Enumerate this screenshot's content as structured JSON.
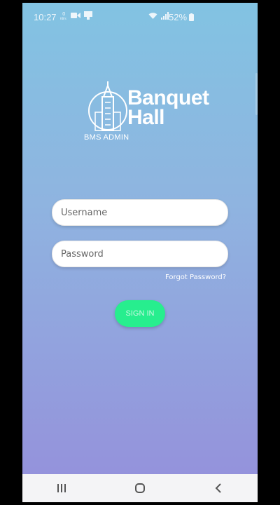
{
  "status_bar": {
    "time": "10:27",
    "battery": "52%",
    "icons_left": [
      "data-icon",
      "video-icon",
      "screen-icon"
    ],
    "icons_right": [
      "wifi-icon",
      "signal-icon",
      "battery-icon"
    ]
  },
  "logo": {
    "title_line1": "Banquet",
    "title_line2": "Hall",
    "subtitle": "BMS ADMIN"
  },
  "form": {
    "username_placeholder": "Username",
    "password_placeholder": "Password",
    "forgot_label": "Forgot Password?",
    "signin_label": "SIGN IN"
  },
  "colors": {
    "bg_top": "#82c3e2",
    "bg_bottom": "#958fdb",
    "signin_button": "#27ee8e"
  }
}
